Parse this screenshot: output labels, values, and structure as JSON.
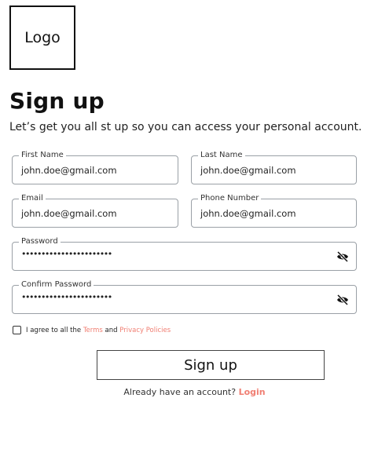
{
  "logo": {
    "text": "Logo"
  },
  "header": {
    "title": "Sign up",
    "subtitle": "Let’s get you all st up so you can access your personal account."
  },
  "form": {
    "first_name": {
      "label": "First Name",
      "value": "john.doe@gmail.com"
    },
    "last_name": {
      "label": "Last Name",
      "value": "john.doe@gmail.com"
    },
    "email": {
      "label": "Email",
      "value": "john.doe@gmail.com"
    },
    "phone": {
      "label": "Phone Number",
      "value": "john.doe@gmail.com"
    },
    "password": {
      "label": "Password",
      "masked_value": "•••••••••••••••••••••••",
      "icon": "eye-slash-icon"
    },
    "confirm_password": {
      "label": "Confirm Password",
      "masked_value": "•••••••••••••••••••••••",
      "icon": "eye-slash-icon"
    }
  },
  "agree": {
    "prefix": "I agree to all the ",
    "terms": "Terms",
    "and": " and ",
    "privacy": "Privacy Policies",
    "checked": false
  },
  "signup_button": {
    "label": "Sign up"
  },
  "login_prompt": {
    "text": "Already have an account? ",
    "link": "Login"
  },
  "colors": {
    "accent": "#f07e72",
    "border": "#9aa0a6",
    "text": "#111111"
  }
}
